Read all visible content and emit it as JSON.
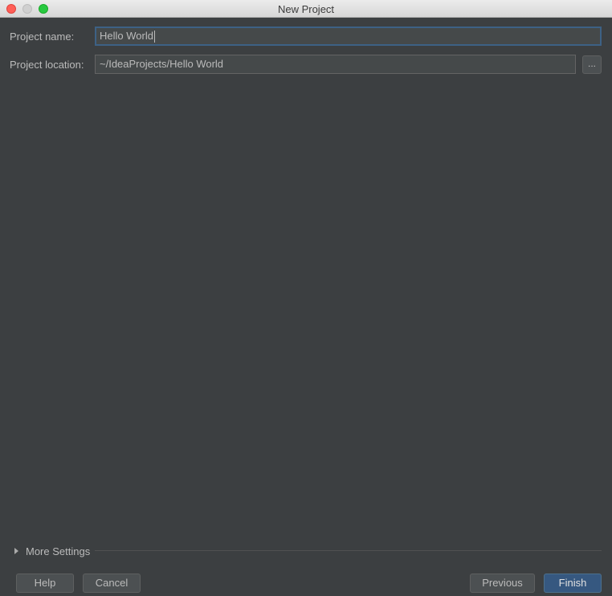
{
  "window": {
    "title": "New Project"
  },
  "form": {
    "project_name_label": "Project name:",
    "project_name_value": "Hello World",
    "project_location_label": "Project location:",
    "project_location_value": "~/IdeaProjects/Hello World",
    "browse_label": "..."
  },
  "more_settings": {
    "label": "More Settings"
  },
  "buttons": {
    "help": "Help",
    "cancel": "Cancel",
    "previous": "Previous",
    "finish": "Finish"
  },
  "colors": {
    "background": "#3c3f41",
    "field_bg": "#45494a",
    "focus_border": "#3d6185",
    "primary_button": "#365880"
  }
}
